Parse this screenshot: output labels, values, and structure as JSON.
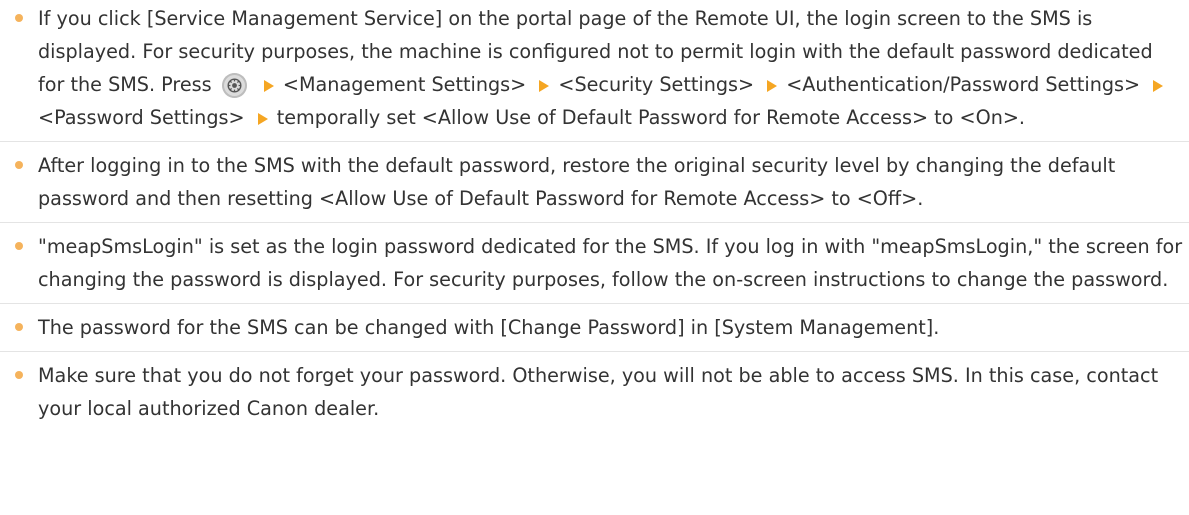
{
  "notes": [
    {
      "segments": [
        "If you click [Service Management Service] on the portal page of the Remote UI, the login screen to the SMS is displayed. For security purposes, the machine is configured not to permit login with the default password dedicated for the SMS. Press",
        "<Management Settings>",
        "<Security Settings>",
        "<Authentication/Password Settings>",
        "<Password Settings>",
        "temporally set <Allow Use of Default Password for Remote Access> to <On>."
      ]
    },
    {
      "text": "After logging in to the SMS with the default password, restore the original security level by changing the default password and then resetting <Allow Use of Default Password for Remote Access> to <Off>."
    },
    {
      "text": "\"meapSmsLogin\" is set as the login password dedicated for the SMS. If you log in with \"meapSmsLogin,\" the screen for changing the password is displayed. For security purposes, follow the on-screen instructions to change the password."
    },
    {
      "text": "The password for the SMS can be changed with [Change Password] in [System Management]."
    },
    {
      "text": "Make sure that you do not forget your password. Otherwise, you will not be able to access SMS. In this case, contact your local authorized Canon dealer."
    }
  ],
  "icons": {
    "bullet": "bullet-dot",
    "arrow": "orange-arrow-right",
    "settings_key": "settings-menu-key-icon"
  },
  "colors": {
    "bullet": "#f5b35c",
    "arrow": "#f5a623",
    "text": "#333333",
    "divider": "#e4e4e4"
  }
}
